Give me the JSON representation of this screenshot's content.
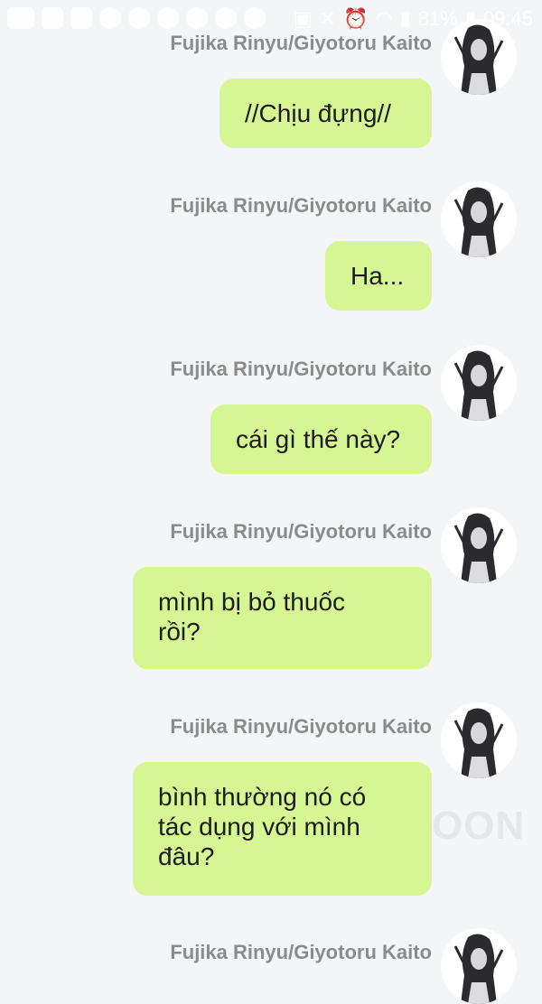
{
  "status_bar": {
    "battery": "81%",
    "time": "09:45",
    "left_icons": [
      "chat-icon",
      "calendar-icon",
      "message-icon",
      "pinterest-icon",
      "spotify-icon",
      "music-icon",
      "emoji-icon",
      "emoji-icon",
      "emoji-icon"
    ],
    "right_icons": [
      "nfc-icon",
      "mute-icon",
      "alarm-icon",
      "wifi-icon",
      "signal-icon",
      "battery-icon"
    ]
  },
  "messages": [
    {
      "sender": "Fujika Rinyu/Giyotoru Kaito",
      "text": "//Chịu đựng//"
    },
    {
      "sender": "Fujika Rinyu/Giyotoru Kaito",
      "text": "Ha..."
    },
    {
      "sender": "Fujika Rinyu/Giyotoru Kaito",
      "text": "cái gì thế này?"
    },
    {
      "sender": "Fujika Rinyu/Giyotoru Kaito",
      "text": "mình bị bỏ thuốc\nrồi?"
    },
    {
      "sender": "Fujika Rinyu/Giyotoru Kaito",
      "text": "bình thường nó có\ntác dụng với mình\nđâu?"
    },
    {
      "sender": "Fujika Rinyu/Giyotoru Kaito",
      "text": ""
    }
  ],
  "watermark": "OON"
}
